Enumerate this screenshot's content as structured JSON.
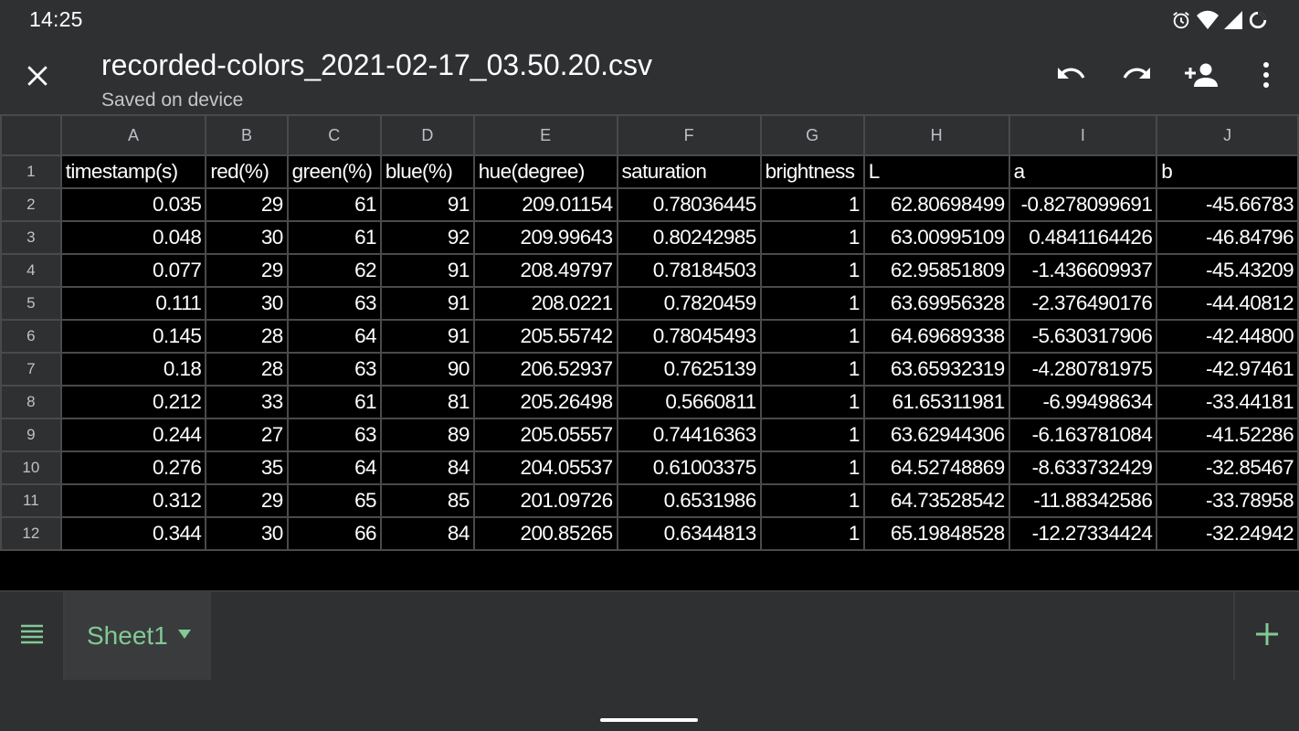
{
  "status_bar": {
    "time": "14:25"
  },
  "document": {
    "title": "recorded-colors_2021-02-17_03.50.20.csv",
    "subtitle": "Saved on device"
  },
  "colors": {
    "accent": "#81c995",
    "background": "#2f3032",
    "grid_background": "#000000"
  },
  "columns": [
    "A",
    "B",
    "C",
    "D",
    "E",
    "F",
    "G",
    "H",
    "I",
    "J"
  ],
  "rows": [
    {
      "num": "1",
      "cells": [
        "timestamp(s)",
        "red(%)",
        "green(%)",
        "blue(%)",
        "hue(degree)",
        "saturation",
        "brightness",
        "L",
        "a",
        "b"
      ]
    },
    {
      "num": "2",
      "cells": [
        "0.035",
        "29",
        "61",
        "91",
        "209.01154",
        "0.78036445",
        "1",
        "62.80698499",
        "-0.8278099691",
        "-45.66783"
      ]
    },
    {
      "num": "3",
      "cells": [
        "0.048",
        "30",
        "61",
        "92",
        "209.99643",
        "0.80242985",
        "1",
        "63.00995109",
        "0.4841164426",
        "-46.84796"
      ]
    },
    {
      "num": "4",
      "cells": [
        "0.077",
        "29",
        "62",
        "91",
        "208.49797",
        "0.78184503",
        "1",
        "62.95851809",
        "-1.436609937",
        "-45.43209"
      ]
    },
    {
      "num": "5",
      "cells": [
        "0.111",
        "30",
        "63",
        "91",
        "208.0221",
        "0.7820459",
        "1",
        "63.69956328",
        "-2.376490176",
        "-44.40812"
      ]
    },
    {
      "num": "6",
      "cells": [
        "0.145",
        "28",
        "64",
        "91",
        "205.55742",
        "0.78045493",
        "1",
        "64.69689338",
        "-5.630317906",
        "-42.44800"
      ]
    },
    {
      "num": "7",
      "cells": [
        "0.18",
        "28",
        "63",
        "90",
        "206.52937",
        "0.7625139",
        "1",
        "63.65932319",
        "-4.280781975",
        "-42.97461"
      ]
    },
    {
      "num": "8",
      "cells": [
        "0.212",
        "33",
        "61",
        "81",
        "205.26498",
        "0.5660811",
        "1",
        "61.65311981",
        "-6.99498634",
        "-33.44181"
      ]
    },
    {
      "num": "9",
      "cells": [
        "0.244",
        "27",
        "63",
        "89",
        "205.05557",
        "0.74416363",
        "1",
        "63.62944306",
        "-6.163781084",
        "-41.52286"
      ]
    },
    {
      "num": "10",
      "cells": [
        "0.276",
        "35",
        "64",
        "84",
        "204.05537",
        "0.61003375",
        "1",
        "64.52748869",
        "-8.633732429",
        "-32.85467"
      ]
    },
    {
      "num": "11",
      "cells": [
        "0.312",
        "29",
        "65",
        "85",
        "201.09726",
        "0.6531986",
        "1",
        "64.73528542",
        "-11.88342586",
        "-33.78958"
      ]
    },
    {
      "num": "12",
      "cells": [
        "0.344",
        "30",
        "66",
        "84",
        "200.85265",
        "0.6344813",
        "1",
        "65.19848528",
        "-12.27334424",
        "-32.24942"
      ]
    }
  ],
  "sheet_tabs": [
    {
      "label": "Sheet1"
    }
  ],
  "icons": {
    "close": "close-icon",
    "undo": "undo-icon",
    "redo": "redo-icon",
    "share": "person-add-icon",
    "more": "more-vert-icon",
    "sheets_menu": "hamburger-menu-icon",
    "add_sheet": "plus-icon",
    "tab_menu": "caret-down-icon",
    "alarm": "alarm-icon",
    "wifi": "wifi-icon",
    "signal": "signal-icon",
    "battery": "battery-icon"
  }
}
